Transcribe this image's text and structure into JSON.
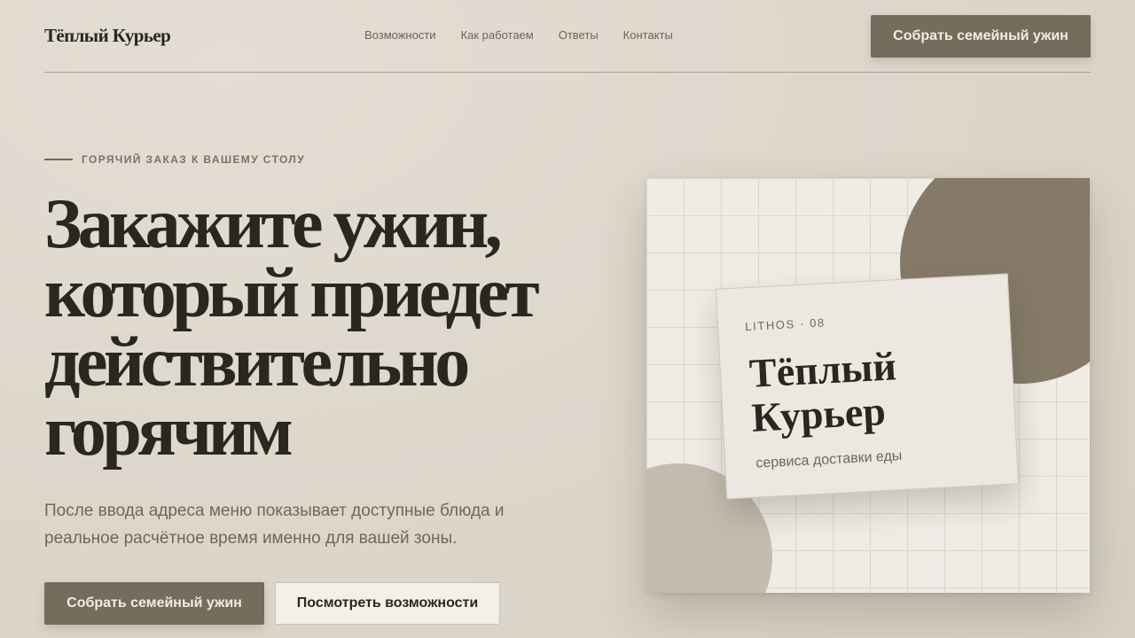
{
  "header": {
    "brand": "Тёплый Курьер",
    "nav": [
      "Возможности",
      "Как работаем",
      "Ответы",
      "Контакты"
    ],
    "cta_label": "Собрать семейный ужин"
  },
  "hero": {
    "eyebrow": "ГОРЯЧИЙ ЗАКАЗ К ВАШЕМУ СТОЛУ",
    "headline": "Закажите ужин, который приедет действительно горячим",
    "lede": "После ввода адреса меню показывает доступные блюда и реальное расчётное время именно для вашей зоны.",
    "primary_label": "Собрать семейный ужин",
    "secondary_label": "Посмотреть возможности"
  },
  "card": {
    "eyebrow": "LITHOS · 08",
    "title": "Тёплый Курьер",
    "subtitle": "сервиса доставки еды"
  },
  "colors": {
    "background": "#ddd6cb",
    "accent": "#766c5b",
    "text": "#2a2720",
    "muted": "#6d675e"
  }
}
